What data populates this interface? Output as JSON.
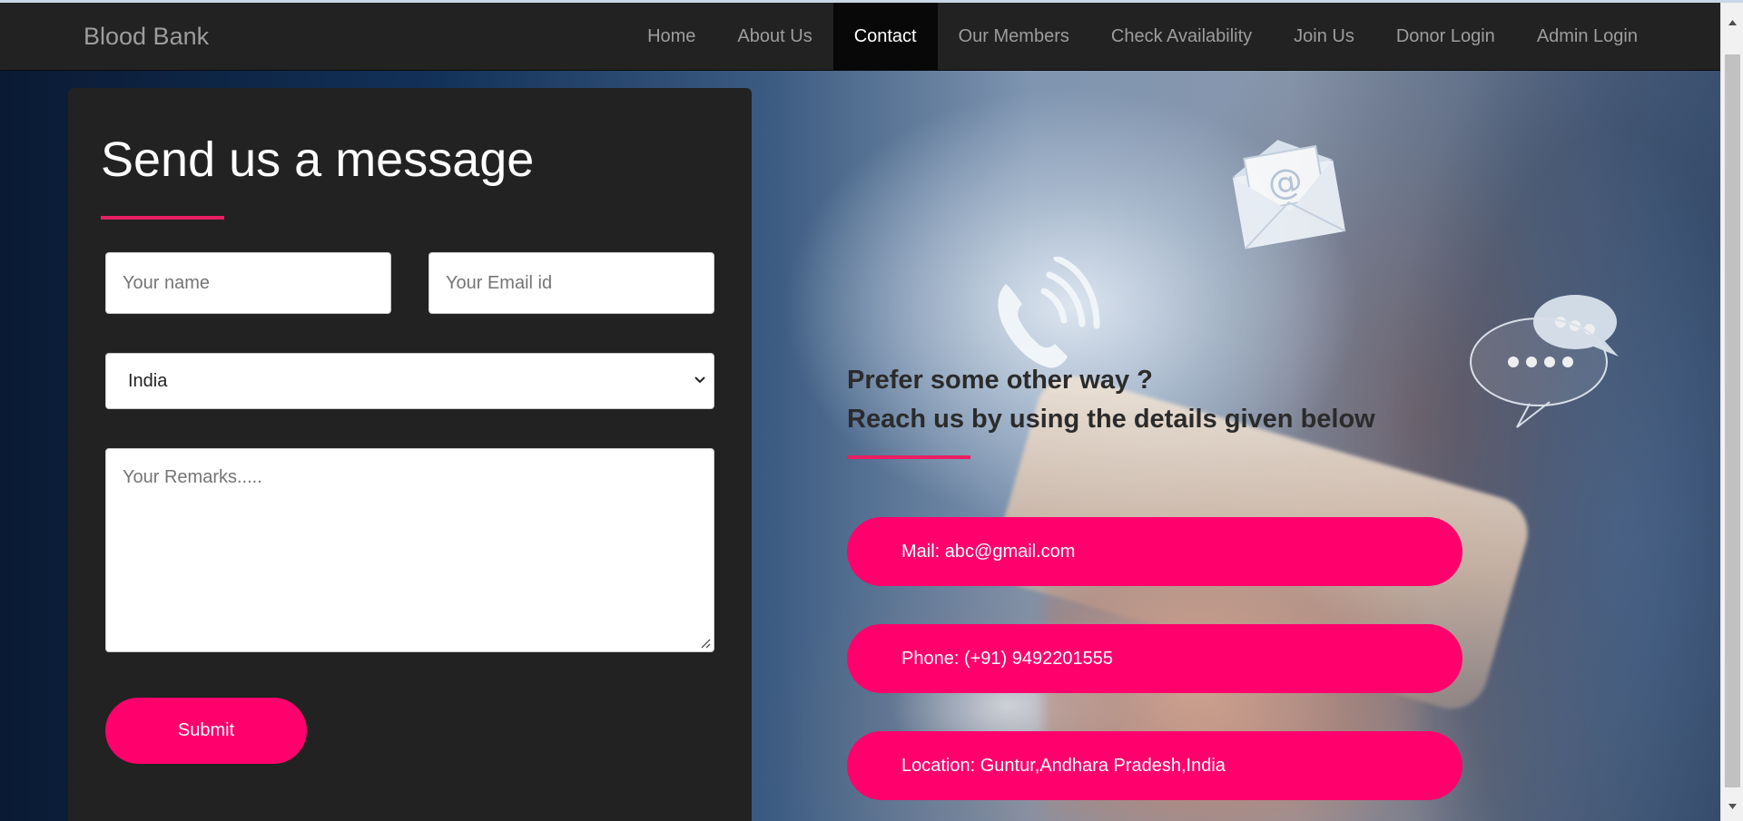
{
  "navbar": {
    "brand": "Blood Bank",
    "links": [
      {
        "label": "Home"
      },
      {
        "label": "About Us"
      },
      {
        "label": "Contact"
      },
      {
        "label": "Our Members"
      },
      {
        "label": "Check Availability"
      },
      {
        "label": "Join Us"
      },
      {
        "label": "Donor Login"
      },
      {
        "label": "Admin Login"
      }
    ],
    "active": "Contact"
  },
  "form": {
    "title": "Send us a message",
    "name_placeholder": "Your name",
    "email_placeholder": "Your Email id",
    "country_value": "India",
    "remarks_placeholder": "Your Remarks.....",
    "submit_label": "Submit"
  },
  "contact": {
    "heading_line1": "Prefer some other way ?",
    "heading_line2": "Reach us by using the details given below",
    "mail": "Mail: abc@gmail.com",
    "phone": "Phone: (+91) 9492201555",
    "location": "Location: Guntur,Andhara Pradesh,India"
  },
  "colors": {
    "accent": "#ff006d",
    "underline": "#e91e63",
    "navbar_bg": "#222222",
    "panel_bg": "#222222"
  },
  "icons": [
    "email-at-icon",
    "phone-ringing-icon",
    "chat-bubbles-icon",
    "chevron-down-icon",
    "resize-grip-icon"
  ]
}
